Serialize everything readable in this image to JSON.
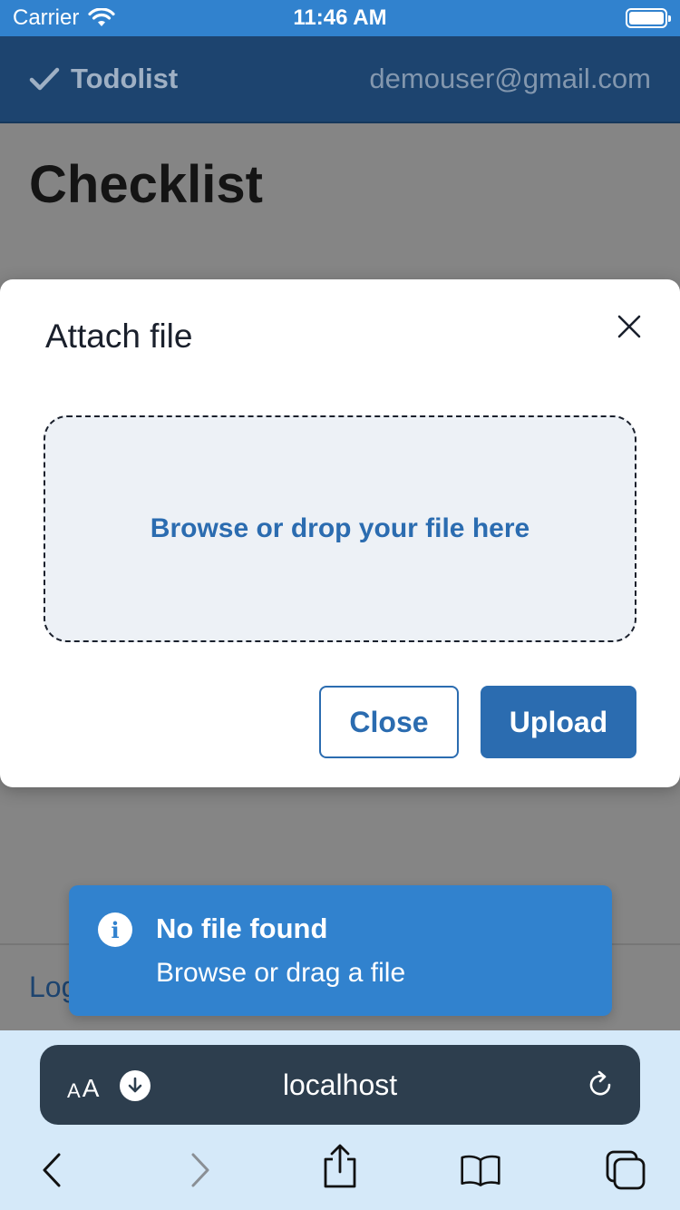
{
  "status_bar": {
    "carrier": "Carrier",
    "time": "11:46 AM"
  },
  "header": {
    "brand": "Todolist",
    "user_email": "demouser@gmail.com"
  },
  "page": {
    "title": "Checklist",
    "logout_partial": "Log"
  },
  "modal": {
    "title": "Attach file",
    "dropzone_text": "Browse or drop your file here",
    "close_label": "Close",
    "upload_label": "Upload"
  },
  "toast": {
    "title": "No file found",
    "description": "Browse or drag a file",
    "icon": "info-icon"
  },
  "browser": {
    "text_size_label": "AA",
    "url": "localhost",
    "toolbar": [
      "back-icon",
      "forward-icon",
      "share-icon",
      "bookmarks-icon",
      "tabs-icon"
    ]
  },
  "colors": {
    "status_bar": "#3182ce",
    "header": "#1d446f",
    "primary": "#2b6cb0",
    "toast": "#3182ce",
    "overlay": "#858585",
    "dropzone_bg": "#edf1f6"
  }
}
